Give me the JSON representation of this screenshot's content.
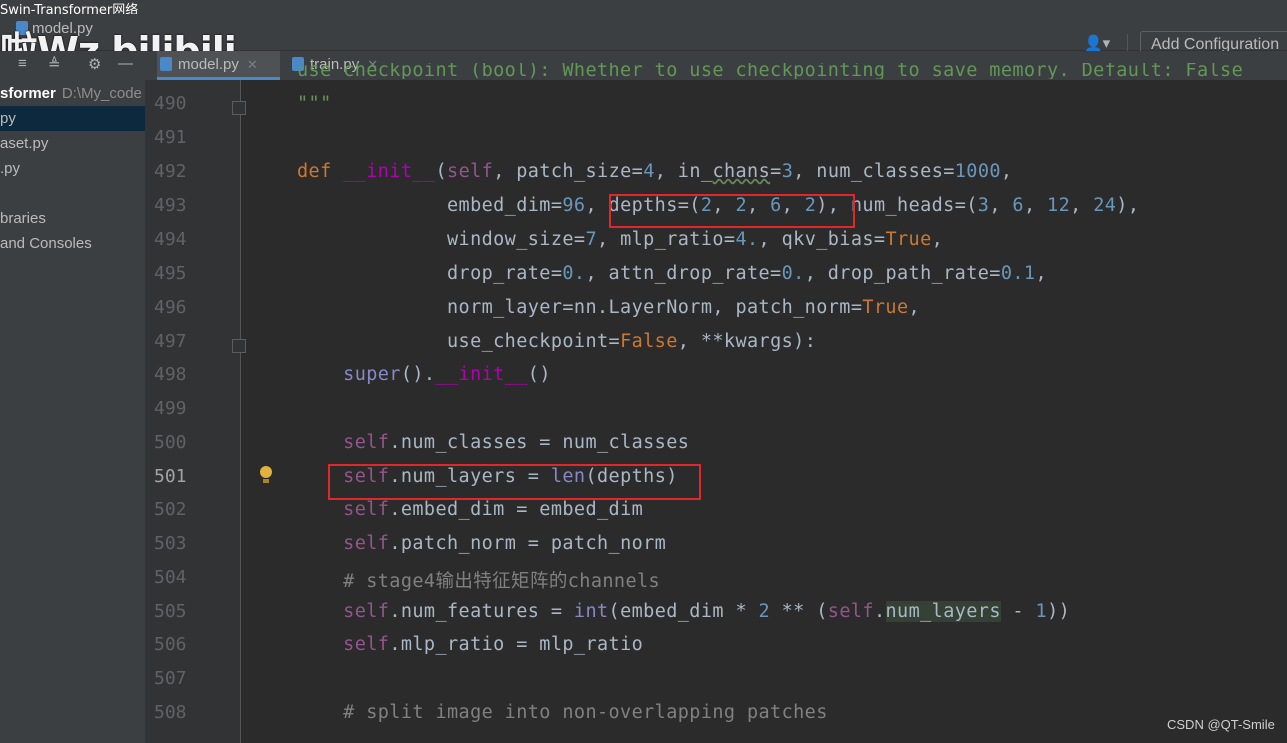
{
  "window": {
    "title": "Swin-Transformer网络"
  },
  "toolbar": {
    "breadcrumb_file": "model.py",
    "watermark": "啦Wz bilibili",
    "user_icon": "user-dropdown-icon",
    "add_configuration": "Add Configuration"
  },
  "project": {
    "root_name": "sformer",
    "root_path": "D:\\My_code",
    "items": [
      "py",
      "aset.py",
      ".py",
      "",
      "braries",
      "and Consoles"
    ]
  },
  "tabs": [
    {
      "label": "model.py",
      "active": true
    },
    {
      "label": "train.py",
      "active": false
    }
  ],
  "lines": [
    {
      "num": "",
      "text": "use_checkpoint (bool): Whether to use checkpointing to save memory. Default: False"
    },
    {
      "num": "490",
      "text": "\"\"\""
    },
    {
      "num": "491",
      "text": ""
    },
    {
      "num": "492",
      "text": "def __init__(self, patch_size=4, in_chans=3, num_classes=1000,"
    },
    {
      "num": "493",
      "text": "             embed_dim=96, depths=(2, 2, 6, 2), num_heads=(3, 6, 12, 24),"
    },
    {
      "num": "494",
      "text": "             window_size=7, mlp_ratio=4., qkv_bias=True,"
    },
    {
      "num": "495",
      "text": "             drop_rate=0., attn_drop_rate=0., drop_path_rate=0.1,"
    },
    {
      "num": "496",
      "text": "             norm_layer=nn.LayerNorm, patch_norm=True,"
    },
    {
      "num": "497",
      "text": "             use_checkpoint=False, **kwargs):"
    },
    {
      "num": "498",
      "text": "    super().__init__()"
    },
    {
      "num": "499",
      "text": ""
    },
    {
      "num": "500",
      "text": "    self.num_classes = num_classes"
    },
    {
      "num": "501",
      "text": "    self.num_layers = len(depths)"
    },
    {
      "num": "502",
      "text": "    self.embed_dim = embed_dim"
    },
    {
      "num": "503",
      "text": "    self.patch_norm = patch_norm"
    },
    {
      "num": "504",
      "text": "    # stage4输出特征矩阵的channels"
    },
    {
      "num": "505",
      "text": "    self.num_features = int(embed_dim * 2 ** (self.num_layers - 1))"
    },
    {
      "num": "506",
      "text": "    self.mlp_ratio = mlp_ratio"
    },
    {
      "num": "507",
      "text": ""
    },
    {
      "num": "508",
      "text": "    # split image into non-overlapping patches"
    }
  ],
  "current_line": "501",
  "footer": {
    "csdn": "CSDN @QT-Smile"
  },
  "colors": {
    "highlight_box": "#e0282c",
    "keyword": "#cc7832",
    "self": "#94558d",
    "number": "#6897bb"
  }
}
